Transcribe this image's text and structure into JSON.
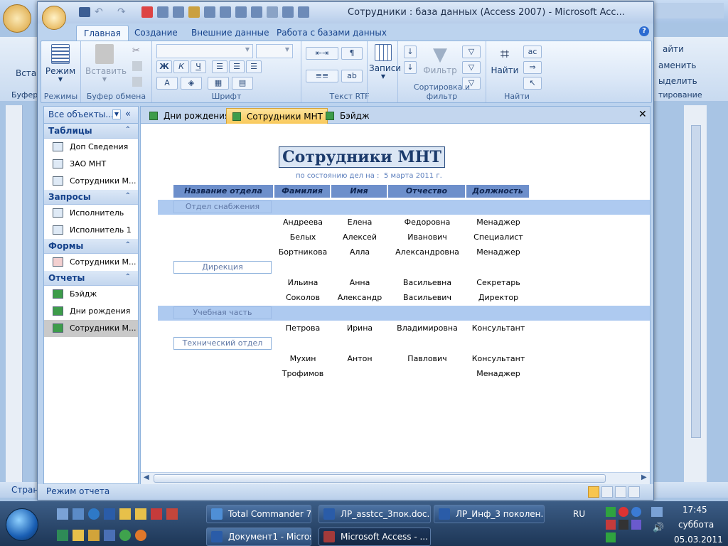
{
  "access_window": {
    "title": "Сотрудники : база данных (Access 2007) - Microsoft Acc...",
    "tabs": [
      "Главная",
      "Создание",
      "Внешние данные",
      "Работа с базами данных"
    ],
    "active_tab": "Главная",
    "ribbon": {
      "views": {
        "button": "Режим",
        "group": "Режимы"
      },
      "clipboard": {
        "button": "Вставить",
        "group": "Буфер обмена"
      },
      "font": {
        "group": "Шрифт",
        "bold": "Ж",
        "italic": "К",
        "underline": "Ч"
      },
      "rtf": {
        "group": "Текст RTF"
      },
      "records": {
        "button": "Записи"
      },
      "sort_filter": {
        "button": "Фильтр",
        "group": "Сортировка и фильтр"
      },
      "find": {
        "button": "Найти",
        "group": "Найти"
      }
    },
    "status": "Режим отчета"
  },
  "nav_pane": {
    "header": "Все объекты...",
    "sections": [
      {
        "title": "Таблицы",
        "items": [
          "Доп Сведения",
          "ЗАО МНТ",
          "Сотрудники М..."
        ]
      },
      {
        "title": "Запросы",
        "items": [
          "Исполнитель",
          "Исполнитель 1"
        ]
      },
      {
        "title": "Формы",
        "items": [
          "Сотрудники М..."
        ]
      },
      {
        "title": "Отчеты",
        "items": [
          "Бэйдж",
          "Дни рождения",
          "Сотрудники М..."
        ]
      }
    ]
  },
  "doc_tabs": [
    "Дни рождения",
    "Сотрудники МНТ",
    "Бэйдж"
  ],
  "report": {
    "title": "Сотрудники МНТ",
    "as_of_label": "по состоянию дел на :",
    "date": "5 марта 2011 г.",
    "columns": [
      "Название отдела",
      "Фамилия",
      "Имя",
      "Отчество",
      "Должность"
    ],
    "departments": [
      {
        "name": "Отдел снабжения",
        "rows": [
          [
            "Андреева",
            "Елена",
            "Федоровна",
            "Менаджер"
          ],
          [
            "Белых",
            "Алексей",
            "Иванович",
            "Специалист"
          ],
          [
            "Бортникова",
            "Алла",
            "Александровна",
            "Менаджер"
          ]
        ]
      },
      {
        "name": "Дирекция",
        "rows": [
          [
            "Ильина",
            "Анна",
            "Васильевна",
            "Секретарь"
          ],
          [
            "Соколов",
            "Александр",
            "Васильевич",
            "Директор"
          ]
        ]
      },
      {
        "name": "Учебная часть",
        "rows": [
          [
            "Петрова",
            "Ирина",
            "Владимировна",
            "Консультант"
          ]
        ]
      },
      {
        "name": "Технический отдел",
        "rows": [
          [
            "Мухин",
            "Антон",
            "Павлович",
            "Консультант"
          ],
          [
            "Трофимов",
            "",
            "",
            "Менаджер"
          ]
        ]
      }
    ]
  },
  "background_word": {
    "ribbon_right": [
      "айти",
      "аменить",
      "ыделить",
      "тирование"
    ],
    "left_labels": [
      "Вста",
      "Буфер"
    ],
    "status_left": "Стран"
  },
  "taskbar": {
    "buttons_row1": [
      "Total Commander 7....",
      "ЛР_asstcc_3пок.doc...",
      "ЛР_Инф_3 поколен..."
    ],
    "buttons_row2": [
      "Документ1 - Micros...",
      "Microsoft Access - ..."
    ],
    "lang": "RU",
    "time": "17:45",
    "weekday": "суббота",
    "date": "05.03.2011"
  }
}
